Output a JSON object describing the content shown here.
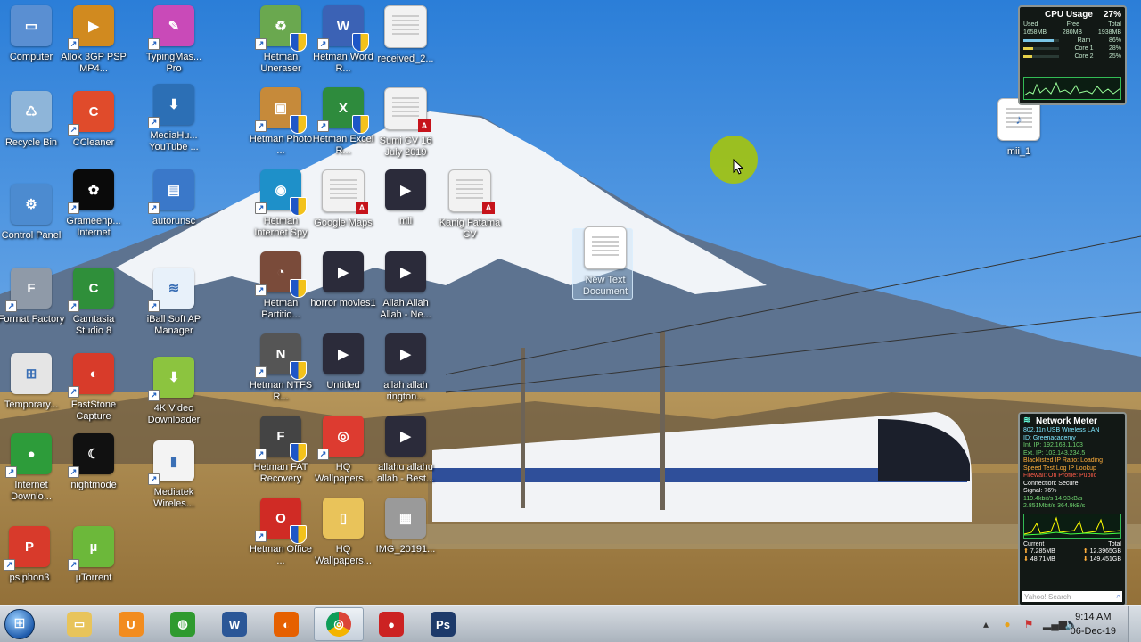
{
  "desktop_icons": [
    {
      "label": "Computer",
      "icon": "computer-icon"
    },
    {
      "label": "Allok 3GP PSP MP4...",
      "icon": "video-converter-icon"
    },
    {
      "label": "TypingMas... Pro",
      "icon": "typingmaster-icon"
    },
    {
      "label": "Hetman Uneraser",
      "icon": "hetman-uneraser-icon"
    },
    {
      "label": "Hetman Word R...",
      "icon": "hetman-word-icon"
    },
    {
      "label": "received_2...",
      "icon": "document-icon"
    },
    {
      "label": "Recycle Bin",
      "icon": "recycle-bin-icon"
    },
    {
      "label": "CCleaner",
      "icon": "ccleaner-icon"
    },
    {
      "label": "MediaHu... YouTube ...",
      "icon": "mediahuman-icon"
    },
    {
      "label": "Hetman Photo ...",
      "icon": "hetman-photo-icon"
    },
    {
      "label": "Hetman Excel R...",
      "icon": "hetman-excel-icon"
    },
    {
      "label": "Sumi CV 16 July 2019",
      "icon": "pdf-icon"
    },
    {
      "label": "Control Panel",
      "icon": "control-panel-icon"
    },
    {
      "label": "Grameenp... Internet",
      "icon": "grameenphone-icon"
    },
    {
      "label": "autorunsc",
      "icon": "autorunsc-icon"
    },
    {
      "label": "Hetman Internet Spy",
      "icon": "hetman-internet-spy-icon"
    },
    {
      "label": "Google Maps",
      "icon": "pdf-icon"
    },
    {
      "label": "mii",
      "icon": "video-file-icon"
    },
    {
      "label": "Kanig Fatama CV",
      "icon": "pdf-icon"
    },
    {
      "label": "New Text Document",
      "icon": "text-document-icon"
    },
    {
      "label": "Format Factory",
      "icon": "format-factory-icon"
    },
    {
      "label": "Camtasia Studio 8",
      "icon": "camtasia-icon"
    },
    {
      "label": "iBall Soft AP Manager",
      "icon": "wifi-icon"
    },
    {
      "label": "Hetman Partitio...",
      "icon": "hetman-partition-icon"
    },
    {
      "label": "horror movies1",
      "icon": "video-file-icon"
    },
    {
      "label": "Allah Allah Allah - Ne...",
      "icon": "video-file-icon"
    },
    {
      "label": "Temporary...",
      "icon": "windows-icon"
    },
    {
      "label": "FastStone Capture",
      "icon": "faststone-icon"
    },
    {
      "label": "4K Video Downloader",
      "icon": "4k-downloader-icon"
    },
    {
      "label": "Hetman NTFS R...",
      "icon": "hetman-ntfs-icon"
    },
    {
      "label": "Untitled",
      "icon": "video-file-icon"
    },
    {
      "label": "allah allah rington...",
      "icon": "video-file-icon"
    },
    {
      "label": "Internet Downlo...",
      "icon": "internet-download-icon"
    },
    {
      "label": "nightmode",
      "icon": "nightmode-icon"
    },
    {
      "label": "Mediatek Wireles...",
      "icon": "mediatek-icon"
    },
    {
      "label": "Hetman FAT Recovery",
      "icon": "hetman-fat-icon"
    },
    {
      "label": "HQ Wallpapers...",
      "icon": "chrome-icon"
    },
    {
      "label": "allahu allahu allah - Best...",
      "icon": "video-file-icon"
    },
    {
      "label": "psiphon3",
      "icon": "psiphon-icon"
    },
    {
      "label": "µTorrent",
      "icon": "utorrent-icon"
    },
    {
      "label": "Hetman Office ...",
      "icon": "hetman-office-icon"
    },
    {
      "label": "HQ Wallpapers...",
      "icon": "folder-icon"
    },
    {
      "label": "IMG_20191...",
      "icon": "image-icon"
    },
    {
      "label": "mii_1",
      "icon": "mp3-file-icon"
    }
  ],
  "cpu_gadget": {
    "title": "CPU Usage",
    "value": "27%",
    "headers": [
      "Used",
      "Free",
      "Total"
    ],
    "values": [
      "1658MB",
      "280MB",
      "1938MB"
    ],
    "rows": [
      {
        "label": "Ram",
        "value": "86%",
        "fraction": 0.86
      },
      {
        "label": "Core 1",
        "value": "28%",
        "fraction": 0.28
      },
      {
        "label": "Core 2",
        "value": "25%",
        "fraction": 0.25
      }
    ]
  },
  "network_gadget": {
    "title": "Network Meter",
    "lines": [
      "802.11n USB Wireless LAN",
      "ID: Greenacademy",
      "Int. IP: 192.168.1.103",
      "Ext. IP: 103.143.234.5",
      "Blacklisted IP Ratio: Loading",
      "Speed Test    Log    IP Lookup",
      "Firewall: On    Profile: Public",
      "Connection: Secure",
      "Signal: 76%",
      "119.4kbit/s    14.93kB/s",
      "2.851Mbit/s    364.9kB/s"
    ],
    "current_label": "Current",
    "total_label": "Total",
    "up_current": "7.285MB",
    "up_total": "12.3965GB",
    "down_current": "48.71MB",
    "down_total": "149.451GB",
    "search_placeholder": "Yahoo! Search"
  },
  "taskbar": {
    "apps": [
      {
        "name": "explorer",
        "icon": "folder-icon",
        "color": "#e8c45b"
      },
      {
        "name": "uc-browser",
        "icon": "uc-browser-icon",
        "color": "#f28c1f"
      },
      {
        "name": "internet-download",
        "icon": "globe-icon",
        "color": "#2f9a2f"
      },
      {
        "name": "word",
        "icon": "word-icon",
        "color": "#2b5797"
      },
      {
        "name": "firefox",
        "icon": "firefox-icon",
        "color": "#e66000"
      },
      {
        "name": "chrome",
        "icon": "chrome-icon",
        "color": "#ffffff"
      },
      {
        "name": "screen-recorder",
        "icon": "recorder-icon",
        "color": "#cc2222"
      },
      {
        "name": "photoshop",
        "icon": "photoshop-icon",
        "color": "#1d3a6a"
      }
    ],
    "clock_time": "9:14 AM",
    "clock_date": "06-Dec-19"
  }
}
